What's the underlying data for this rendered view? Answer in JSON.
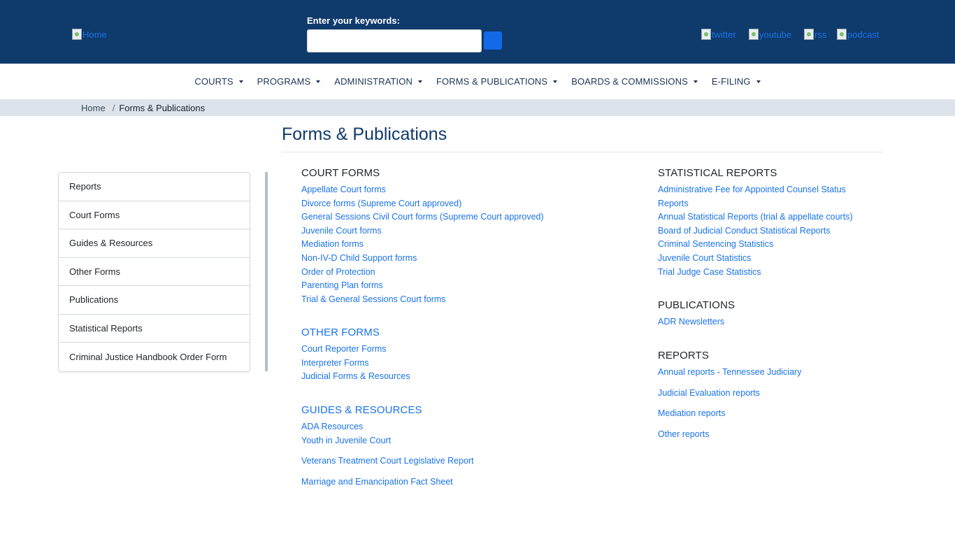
{
  "header": {
    "home_alt": "Home",
    "search_label": "Enter your keywords:",
    "search_value": "",
    "social": [
      "twitter",
      "youtube",
      "rss",
      "podcast"
    ]
  },
  "nav": {
    "items": [
      "COURTS",
      "PROGRAMS",
      "ADMINISTRATION",
      "FORMS & PUBLICATIONS",
      "BOARDS & COMMISSIONS",
      "E-FILING"
    ]
  },
  "breadcrumb": {
    "home": "Home",
    "separator": "/",
    "current": "Forms & Publications"
  },
  "page": {
    "title": "Forms & Publications"
  },
  "sidebar": {
    "items": [
      "Reports",
      "Court Forms",
      "Guides & Resources",
      "Other Forms",
      "Publications",
      "Statistical Reports",
      "Criminal Justice Handbook Order Form"
    ]
  },
  "court_forms": {
    "heading": "COURT FORMS",
    "links": [
      "Appellate Court forms",
      "Divorce forms (Supreme Court approved)",
      "General Sessions Civil Court forms (Supreme Court approved)",
      "Juvenile Court forms",
      "Mediation forms",
      "Non-IV-D Child Support forms",
      "Order of Protection",
      "Parenting Plan forms",
      "Trial & General Sessions Court forms"
    ]
  },
  "other_forms": {
    "heading": "OTHER FORMS",
    "links": [
      "Court Reporter Forms",
      "Interpreter Forms",
      "Judicial Forms & Resources"
    ]
  },
  "guides": {
    "heading": "GUIDES & RESOURCES",
    "links": [
      "ADA Resources",
      "Youth in Juvenile Court",
      "Veterans Treatment Court Legislative Report",
      "Marriage and Emancipation Fact Sheet"
    ]
  },
  "statistical_reports": {
    "heading": "STATISTICAL REPORTS",
    "links": [
      "Administrative Fee for Appointed Counsel Status Reports",
      "Annual Statistical Reports (trial & appellate courts)",
      "Board of Judicial Conduct Statistical Reports",
      "Criminal Sentencing Statistics",
      "Juvenile Court Statistics",
      "Trial Judge Case Statistics"
    ]
  },
  "publications": {
    "heading": "PUBLICATIONS",
    "links": [
      "ADR Newsletters"
    ]
  },
  "reports": {
    "heading": "REPORTS",
    "links": [
      "Annual reports - Tennessee Judiciary",
      "Judicial Evaluation reports",
      "Mediation reports",
      "Other reports"
    ]
  },
  "colors": {
    "header_bg": "#0f3a6c",
    "link": "#1a73e8",
    "search_button": "#1469e8",
    "breadcrumb_bg": "#dce3ea"
  }
}
